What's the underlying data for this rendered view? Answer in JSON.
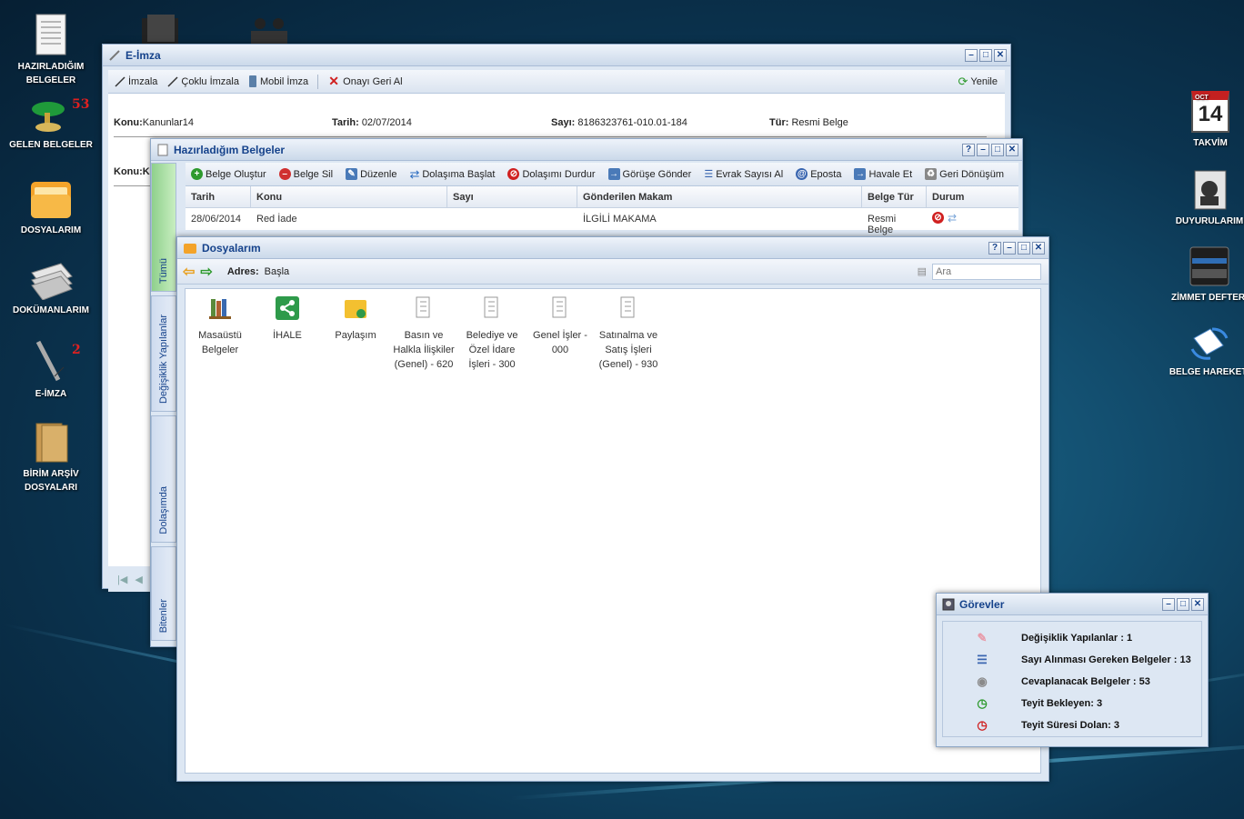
{
  "desktop_left": [
    {
      "label_line1": "HAZIRLADIĞIM",
      "label_line2": "BELGELER",
      "icon": "document-list-icon"
    },
    {
      "label_line1": "GELEN BELGELER",
      "label_line2": "",
      "icon": "incoming-lamp-icon",
      "badge": "53"
    },
    {
      "label_line1": "DOSYALARIM",
      "label_line2": "",
      "icon": "folder-icon"
    },
    {
      "label_line1": "DOKÜMANLARIM",
      "label_line2": "",
      "icon": "paper-stack-icon"
    },
    {
      "label_line1": "E-İMZA",
      "label_line2": "",
      "icon": "pen-icon",
      "badge": "2"
    },
    {
      "label_line1": "BİRİM ARŞİV",
      "label_line2": "DOSYALARI",
      "icon": "archive-folder-icon"
    }
  ],
  "desktop_right": [
    {
      "label": "TAKVİM",
      "icon": "calendar-icon",
      "day": "14",
      "month": "OCT"
    },
    {
      "label": "DUYURULARIM",
      "icon": "announcement-icon"
    },
    {
      "label": "ZİMMET DEFTERİ",
      "icon": "ledger-icon"
    },
    {
      "label": "BELGE HAREKETİ",
      "icon": "document-movement-icon"
    }
  ],
  "eimza": {
    "title": "E-İmza",
    "toolbar": {
      "sign": "İmzala",
      "multi_sign": "Çoklu İmzala",
      "mobile_sign": "Mobil İmza",
      "revoke": "Onayı Geri Al",
      "refresh": "Yenile"
    },
    "meta": {
      "konu_label": "Konu:",
      "konu": "Kanunlar14",
      "tarih_label": "Tarih:",
      "tarih": "02/07/2014",
      "sayi_label": "Sayı:",
      "sayi": "8186323761-010.01-184",
      "tur_label": "Tür:",
      "tur": "Resmi Belge"
    },
    "second_konu": "Konu:Ka"
  },
  "hazir": {
    "title": "Hazırladığım Belgeler",
    "tabs": {
      "all": "Tümü",
      "changed": "Değişiklik Yapılanlar",
      "circulating": "Dolaşımda",
      "finished": "Bitenler"
    },
    "toolbar": {
      "create": "Belge Oluştur",
      "delete": "Belge Sil",
      "edit": "Düzenle",
      "start": "Dolaşıma Başlat",
      "stop": "Dolaşımı Durdur",
      "send_opinion": "Görüşe Gönder",
      "get_number": "Evrak Sayısı Al",
      "email": "Eposta",
      "forward": "Havale Et",
      "return": "Geri Dönüşüm"
    },
    "columns": [
      "Tarih",
      "Konu",
      "Sayı",
      "Gönderilen Makam",
      "Belge Tür",
      "Durum"
    ],
    "rows": [
      {
        "tarih": "28/06/2014",
        "konu": "Red İade",
        "sayi": "",
        "makam": "İLGİLİ MAKAMA",
        "tur": "Resmi Belge"
      }
    ]
  },
  "dosyalarim": {
    "title": "Dosyalarım",
    "address_label": "Adres:",
    "address_value": "Başla",
    "search_placeholder": "Ara",
    "items": [
      {
        "l1": "Masaüstü",
        "l2": "Belgeler",
        "l3": "",
        "icon": "books-icon"
      },
      {
        "l1": "İHALE",
        "l2": "",
        "l3": "",
        "icon": "share-icon"
      },
      {
        "l1": "Paylaşım",
        "l2": "",
        "l3": "",
        "icon": "shared-folder-icon"
      },
      {
        "l1": "Basın ve",
        "l2": "Halkla İlişkiler",
        "l3": "(Genel) - 620",
        "icon": "folder-tree-icon"
      },
      {
        "l1": "Belediye ve",
        "l2": "Özel İdare",
        "l3": "İşleri - 300",
        "icon": "folder-tree-icon"
      },
      {
        "l1": "Genel İşler -",
        "l2": "000",
        "l3": "",
        "icon": "folder-tree-icon"
      },
      {
        "l1": "Satınalma ve",
        "l2": "Satış İşleri",
        "l3": "(Genel) - 930",
        "icon": "folder-tree-icon"
      }
    ]
  },
  "gorevler": {
    "title": "Görevler",
    "items": [
      {
        "label": "Değişiklik Yapılanlar : 1",
        "icon": "edit-flag-icon",
        "color": "#e89aa8"
      },
      {
        "label": "Sayı Alınması Gereken Belgeler : 13",
        "icon": "numbered-list-icon",
        "color": "#3a66b0"
      },
      {
        "label": "Cevaplanacak Belgeler : 53",
        "icon": "reply-icon",
        "color": "#8a8a8a"
      },
      {
        "label": "Teyit Bekleyen: 3",
        "icon": "clock-green-icon",
        "color": "#2e9a2e"
      },
      {
        "label": "Teyit Süresi Dolan: 3",
        "icon": "clock-red-icon",
        "color": "#d02020"
      }
    ]
  }
}
